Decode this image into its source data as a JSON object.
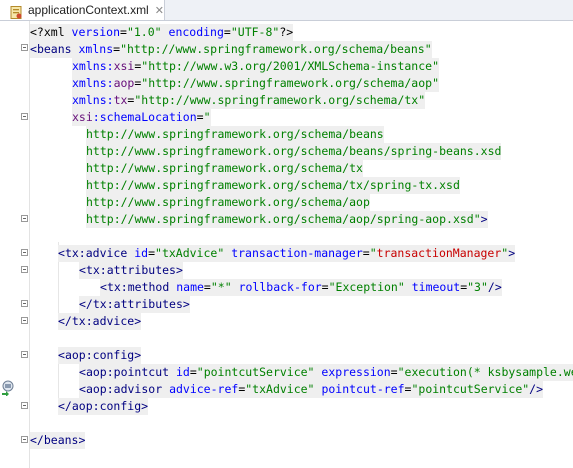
{
  "tab": {
    "label": "applicationContext.xml",
    "icon": "xml-file-icon"
  },
  "gutter_icon": "aop-navigation-icon",
  "lines": {
    "l1": {
      "p1": "<?xml ",
      "a1": "version",
      "e1": "=",
      "v1": "\"1.0\"",
      "s1": " ",
      "a2": "encoding",
      "e2": "=",
      "v2": "\"UTF-8\"",
      "p2": "?>"
    },
    "l2": {
      "p1": "<",
      "t": "beans",
      "s": " ",
      "a": "xmlns",
      "e": "=",
      "v": "\"http://www.springframework.org/schema/beans\""
    },
    "l3": {
      "ns": "xmlns",
      "c": ":",
      "n": "xsi",
      "e": "=",
      "v": "\"http://www.w3.org/2001/XMLSchema-instance\""
    },
    "l4": {
      "ns": "xmlns",
      "c": ":",
      "n": "aop",
      "e": "=",
      "v": "\"http://www.springframework.org/schema/aop\""
    },
    "l5": {
      "ns": "xmlns",
      "c": ":",
      "n": "tx",
      "e": "=",
      "v": "\"http://www.springframework.org/schema/tx\""
    },
    "l6": {
      "ns": "xsi",
      "c": ":",
      "n": "schemaLocation",
      "e": "=",
      "v": "\""
    },
    "l7": {
      "v": "http://www.springframework.org/schema/beans"
    },
    "l8": {
      "v": "http://www.springframework.org/schema/beans/spring-beans.xsd"
    },
    "l9": {
      "v": "http://www.springframework.org/schema/tx"
    },
    "l10": {
      "v": "http://www.springframework.org/schema/tx/spring-tx.xsd"
    },
    "l11": {
      "v": "http://www.springframework.org/schema/aop"
    },
    "l12": {
      "v": "http://www.springframework.org/schema/aop/spring-aop.xsd\"",
      "p": ">"
    },
    "l14": {
      "p1": "<",
      "ns": "tx",
      "c": ":",
      "t": "advice",
      "s1": " ",
      "a1": "id",
      "e1": "=",
      "v1": "\"txAdvice\"",
      "s2": " ",
      "a2": "transaction-manager",
      "e2": "=",
      "v2a": "\"",
      "v2b": "transactionManager",
      "v2c": "\"",
      "p2": ">"
    },
    "l15": {
      "p1": "<",
      "ns": "tx",
      "c": ":",
      "t": "attributes",
      "p2": ">"
    },
    "l16": {
      "p1": "<",
      "ns": "tx",
      "c": ":",
      "t": "method",
      "s1": " ",
      "a1": "name",
      "e1": "=",
      "v1": "\"*\"",
      "s2": " ",
      "a2": "rollback-for",
      "e2": "=",
      "v2": "\"Exception\"",
      "s3": " ",
      "a3": "timeout",
      "e3": "=",
      "v3": "\"3\"",
      "p2": "/>"
    },
    "l17": {
      "p1": "</",
      "ns": "tx",
      "c": ":",
      "t": "attributes",
      "p2": ">"
    },
    "l18": {
      "p1": "</",
      "ns": "tx",
      "c": ":",
      "t": "advice",
      "p2": ">"
    },
    "l20": {
      "p1": "<",
      "ns": "aop",
      "c": ":",
      "t": "config",
      "p2": ">"
    },
    "l21": {
      "p1": "<",
      "ns": "aop",
      "c": ":",
      "t": "pointcut",
      "s1": " ",
      "a1": "id",
      "e1": "=",
      "v1": "\"pointcutService\"",
      "s2": " ",
      "a2": "expression",
      "e2": "=",
      "v2": "\"execution(* ksbysample.webapp"
    },
    "l22": {
      "p1": "<",
      "ns": "aop",
      "c": ":",
      "t": "advisor",
      "s1": " ",
      "a1": "advice-ref",
      "e1": "=",
      "v1": "\"txAdvice\"",
      "s2": " ",
      "a2": "pointcut-ref",
      "e2": "=",
      "v2": "\"pointcutService\"",
      "p2": "/>"
    },
    "l23": {
      "p1": "</",
      "ns": "aop",
      "c": ":",
      "t": "config",
      "p2": ">"
    },
    "l25": {
      "p1": "</",
      "t": "beans",
      "p2": ">"
    }
  }
}
